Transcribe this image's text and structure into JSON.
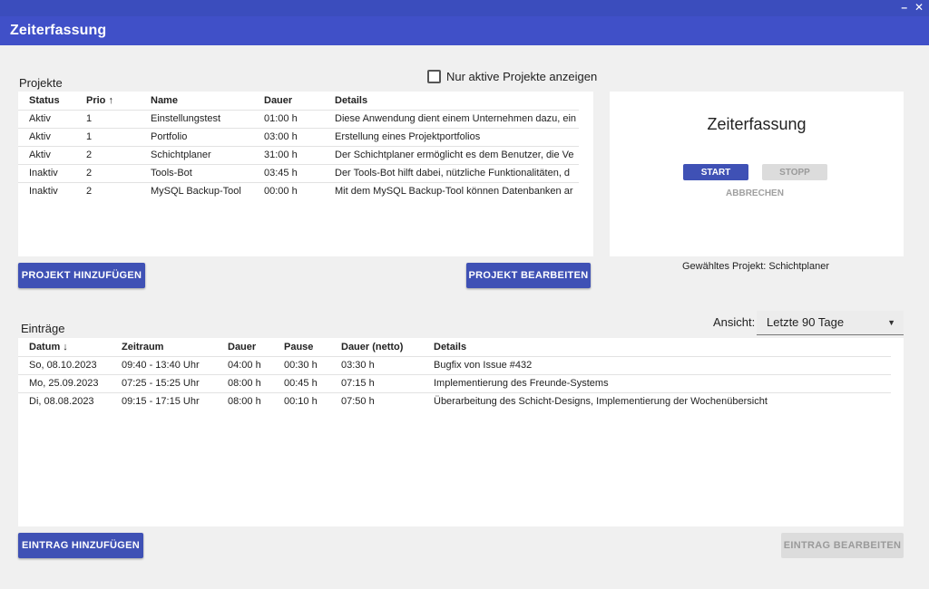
{
  "window": {
    "minimize_label": "–",
    "close_label": "✕"
  },
  "app": {
    "title": "Zeiterfassung",
    "bar_color": "#4050c8",
    "accent_color": "#3f51b5"
  },
  "projects": {
    "section_label": "Projekte",
    "active_filter_label": "Nur aktive Projekte anzeigen",
    "active_filter_checked": false,
    "columns": {
      "status": "Status",
      "prio": "Prio ↑",
      "name": "Name",
      "dauer": "Dauer",
      "details": "Details"
    },
    "rows": [
      {
        "status": "Aktiv",
        "prio": "1",
        "name": "Einstellungstest",
        "dauer": "01:00 h",
        "details": "Diese Anwendung dient einem Unternehmen dazu, ein"
      },
      {
        "status": "Aktiv",
        "prio": "1",
        "name": "Portfolio",
        "dauer": "03:00 h",
        "details": "Erstellung eines Projektportfolios"
      },
      {
        "status": "Aktiv",
        "prio": "2",
        "name": "Schichtplaner",
        "dauer": "31:00 h",
        "details": "Der Schichtplaner ermöglicht es dem Benutzer, die Ve"
      },
      {
        "status": "Inaktiv",
        "prio": "2",
        "name": "Tools-Bot",
        "dauer": "03:45 h",
        "details": "Der Tools-Bot hilft dabei, nützliche Funktionalitäten, d"
      },
      {
        "status": "Inaktiv",
        "prio": "2",
        "name": "MySQL Backup-Tool",
        "dauer": "00:00 h",
        "details": "Mit dem MySQL Backup-Tool können Datenbanken ar"
      }
    ],
    "add_button": "Projekt hinzufügen",
    "edit_button": "Projekt bearbeiten"
  },
  "timer": {
    "title": "Zeiterfassung",
    "start_label": "START",
    "stop_label": "STOPP",
    "cancel_label": "ABBRECHEN",
    "selected_project_text": "Gewähltes Projekt: Schichtplaner"
  },
  "entries": {
    "section_label": "Einträge",
    "view_label": "Ansicht:",
    "view_selected": "Letzte 90 Tage",
    "columns": {
      "datum": "Datum ↓",
      "zeitraum": "Zeitraum",
      "dauer": "Dauer",
      "pause": "Pause",
      "netto": "Dauer (netto)",
      "details": "Details"
    },
    "rows": [
      {
        "datum": "So, 08.10.2023",
        "zeitraum": "09:40 - 13:40 Uhr",
        "dauer": "04:00 h",
        "pause": "00:30 h",
        "netto": "03:30 h",
        "details": "Bugfix von Issue #432"
      },
      {
        "datum": "Mo, 25.09.2023",
        "zeitraum": "07:25 - 15:25 Uhr",
        "dauer": "08:00 h",
        "pause": "00:45 h",
        "netto": "07:15 h",
        "details": "Implementierung des Freunde-Systems"
      },
      {
        "datum": "Di, 08.08.2023",
        "zeitraum": "09:15 - 17:15 Uhr",
        "dauer": "08:00 h",
        "pause": "00:10 h",
        "netto": "07:50 h",
        "details": "Überarbeitung des Schicht-Designs, Implementierung der Wochenübersicht"
      }
    ],
    "add_button": "Eintrag hinzufügen",
    "edit_button": "Eintrag bearbeiten"
  }
}
